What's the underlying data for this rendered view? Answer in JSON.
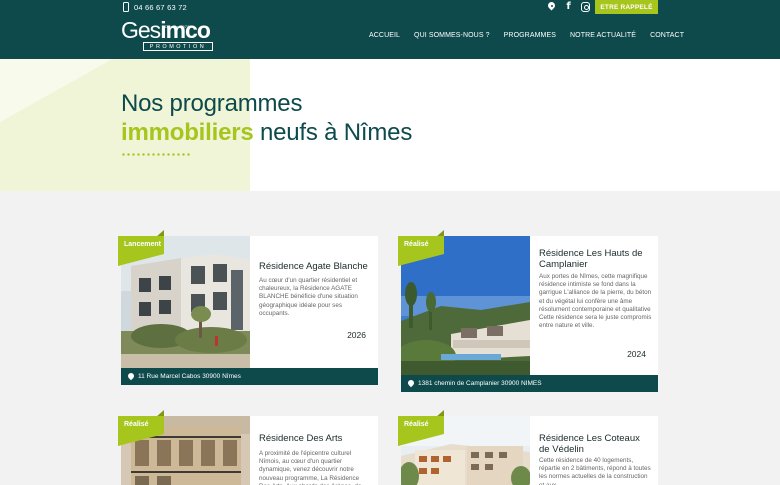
{
  "header": {
    "phone": "04 66 67 63 72",
    "callback_label": "ETRE RAPPELÉ",
    "logo": {
      "word1": "Ges",
      "word2": "imco",
      "since": "Depuis 1978",
      "sub": "PROMOTION"
    },
    "nav": [
      "ACCUEIL",
      "QUI SOMMES-NOUS ?",
      "PROGRAMMES",
      "NOTRE ACTUALITÉ",
      "CONTACT"
    ],
    "social_icons": [
      "map-pin-icon",
      "facebook-icon",
      "instagram-icon"
    ]
  },
  "hero": {
    "line1": "Nos programmes",
    "accent": "immobiliers",
    "line2_rest": " neufs à Nîmes"
  },
  "colors": {
    "primary": "#0e4a4c",
    "accent": "#a6c51d",
    "hero_tint": "#eff5d6"
  },
  "cards": [
    {
      "badge": "Lancement",
      "title": "Résidence Agate Blanche",
      "desc": "Au cœur d'un quartier résidentiel et chaleureux, la Résidence AGATE BLANCHE bénéficie d'une situation géographique idéale pour ses occupants.",
      "year": "2026",
      "address": "11 Rue Marcel Cabos 30900 Nîmes"
    },
    {
      "badge": "Réalisé",
      "title": "Résidence Les Hauts de Camplanier",
      "desc": "Aux portes de Nîmes, cette magnifique résidence intimiste se fond dans la garrigue L'alliance de la pierre, du béton et du végétal lui confère une âme résolument contemporaine et qualitative Cette résidence sera le juste compromis entre nature et ville.",
      "year": "2024",
      "address": "1381 chemin de Camplanier 30900 NIMES"
    },
    {
      "badge": "Réalisé",
      "title": "Résidence Des Arts",
      "desc": "A proximité de l'épicentre culturel Nîmois, au cœur d'un quartier dynamique, venez découvrir notre nouveau programme, La Résidence Des Arts. Aux abords des Arènes, de",
      "year": "",
      "address": ""
    },
    {
      "badge": "Réalisé",
      "title": "Résidence Les Coteaux de Védelin",
      "desc": "Cette résidence de 40 logements, répartie en 2 bâtiments, répond à toutes les normes actuelles de la construction et aux",
      "year": "",
      "address": ""
    }
  ]
}
